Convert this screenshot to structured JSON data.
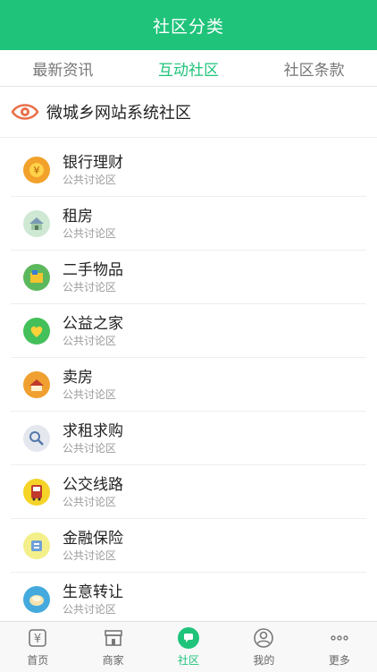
{
  "header": {
    "title": "社区分类"
  },
  "tabs": [
    {
      "label": "最新资讯",
      "active": false
    },
    {
      "label": "互动社区",
      "active": true
    },
    {
      "label": "社区条款",
      "active": false
    }
  ],
  "section": {
    "title": "微城乡网站系统社区",
    "icon": "eye-icon"
  },
  "list": [
    {
      "name": "银行理财",
      "sub": "公共讨论区",
      "icon": "finance-icon"
    },
    {
      "name": "租房",
      "sub": "公共讨论区",
      "icon": "house-icon"
    },
    {
      "name": "二手物品",
      "sub": "公共讨论区",
      "icon": "secondhand-icon"
    },
    {
      "name": "公益之家",
      "sub": "公共讨论区",
      "icon": "heart-icon"
    },
    {
      "name": "卖房",
      "sub": "公共讨论区",
      "icon": "sell-house-icon"
    },
    {
      "name": "求租求购",
      "sub": "公共讨论区",
      "icon": "search-icon"
    },
    {
      "name": "公交线路",
      "sub": "公共讨论区",
      "icon": "bus-icon"
    },
    {
      "name": "金融保险",
      "sub": "公共讨论区",
      "icon": "insurance-icon"
    },
    {
      "name": "生意转让",
      "sub": "公共讨论区",
      "icon": "business-icon"
    }
  ],
  "nav": [
    {
      "label": "首页",
      "icon": "home-icon",
      "active": false
    },
    {
      "label": "商家",
      "icon": "shop-icon",
      "active": false
    },
    {
      "label": "社区",
      "icon": "community-icon",
      "active": true
    },
    {
      "label": "我的",
      "icon": "user-icon",
      "active": false
    },
    {
      "label": "更多",
      "icon": "more-icon",
      "active": false
    }
  ],
  "colors": {
    "accent": "#1fc37a",
    "eye": "#e8704a"
  }
}
